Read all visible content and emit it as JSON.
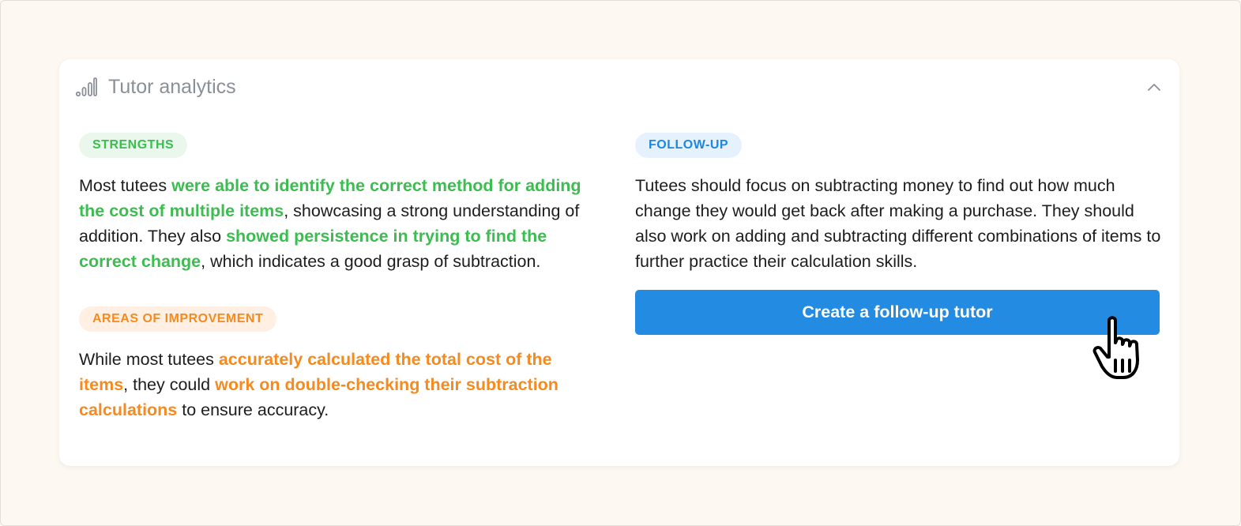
{
  "card": {
    "title": "Tutor analytics",
    "header_icon": "signal-bars-icon",
    "collapse_icon": "chevron-up-icon"
  },
  "strengths": {
    "badge": "STRENGTHS",
    "segments": [
      {
        "text": "Most tutees ",
        "highlight": false
      },
      {
        "text": "were able to identify the correct method for adding the cost of multiple items",
        "highlight": true
      },
      {
        "text": ", showcasing a strong understanding of addition. They also ",
        "highlight": false
      },
      {
        "text": "showed persistence in trying to find the correct change",
        "highlight": true
      },
      {
        "text": ", which indicates a good grasp of subtraction.",
        "highlight": false
      }
    ]
  },
  "improvement": {
    "badge": "AREAS OF IMPROVEMENT",
    "segments": [
      {
        "text": "While most tutees ",
        "highlight": false
      },
      {
        "text": "accurately calculated the total cost of the items",
        "highlight": true
      },
      {
        "text": ", they could ",
        "highlight": false
      },
      {
        "text": "work on double-checking their subtraction calculations",
        "highlight": true
      },
      {
        "text": " to ensure accuracy.",
        "highlight": false
      }
    ]
  },
  "followup": {
    "badge": "FOLLOW-UP",
    "text": "Tutees should focus on subtracting money to find out how much change they would get back after making a purchase. They should also work on adding and subtracting different combinations of items to further practice their calculation skills.",
    "button_label": "Create a follow-up tutor"
  },
  "cursor_icon": "hand-pointer-icon",
  "colors": {
    "green": "#3bbd4f",
    "orange": "#f58a1f",
    "blue": "#1f86e2",
    "button": "#248be2",
    "background": "#fdf9f2"
  }
}
